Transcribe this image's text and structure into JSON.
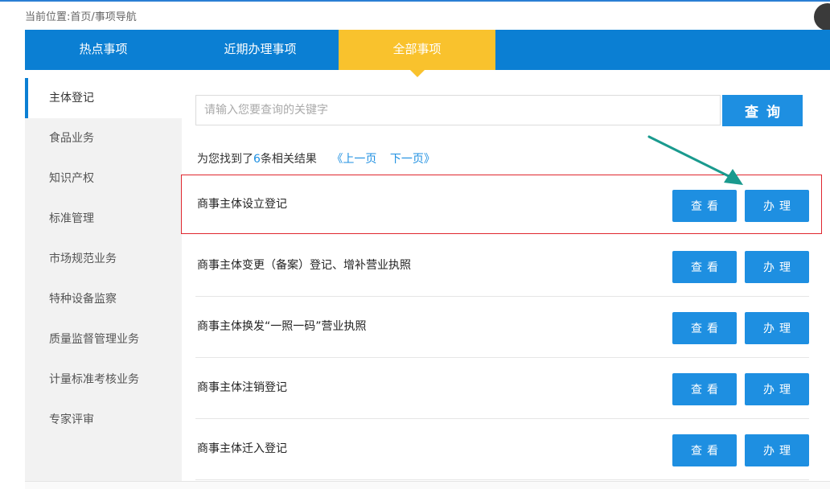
{
  "breadcrumb": "当前位置:首页/事项导航",
  "tabs": [
    {
      "label": "热点事项",
      "active": false
    },
    {
      "label": "近期办理事项",
      "active": false
    },
    {
      "label": "全部事项",
      "active": true
    }
  ],
  "sidebar": {
    "items": [
      {
        "label": "主体登记",
        "active": true
      },
      {
        "label": "食品业务"
      },
      {
        "label": "知识产权"
      },
      {
        "label": "标准管理"
      },
      {
        "label": "市场规范业务"
      },
      {
        "label": "特种设备监察"
      },
      {
        "label": "质量监督管理业务"
      },
      {
        "label": "计量标准考核业务"
      },
      {
        "label": "专家评审"
      }
    ]
  },
  "search": {
    "placeholder": "请输入您要查询的关键字",
    "value": "",
    "button_label": "查询"
  },
  "results": {
    "prefix": "为您找到了",
    "count": "6",
    "suffix": "条相关结果",
    "prev_label": "《上一页",
    "next_label": "下一页》"
  },
  "items": [
    {
      "title": "商事主体设立登记",
      "view_label": "查看",
      "handle_label": "办理"
    },
    {
      "title": "商事主体变更（备案）登记、增补营业执照",
      "view_label": "查看",
      "handle_label": "办理"
    },
    {
      "title": "商事主体换发“一照一码”营业执照",
      "view_label": "查看",
      "handle_label": "办理"
    },
    {
      "title": "商事主体注销登记",
      "view_label": "查看",
      "handle_label": "办理"
    },
    {
      "title": "商事主体迁入登记",
      "view_label": "查看",
      "handle_label": "办理"
    }
  ],
  "colors": {
    "tab_bar": "#0b7fd3",
    "tab_active": "#f9c22d",
    "button": "#1e8fe1",
    "highlight": "#e0272f",
    "arrow": "#1a9a8e"
  }
}
